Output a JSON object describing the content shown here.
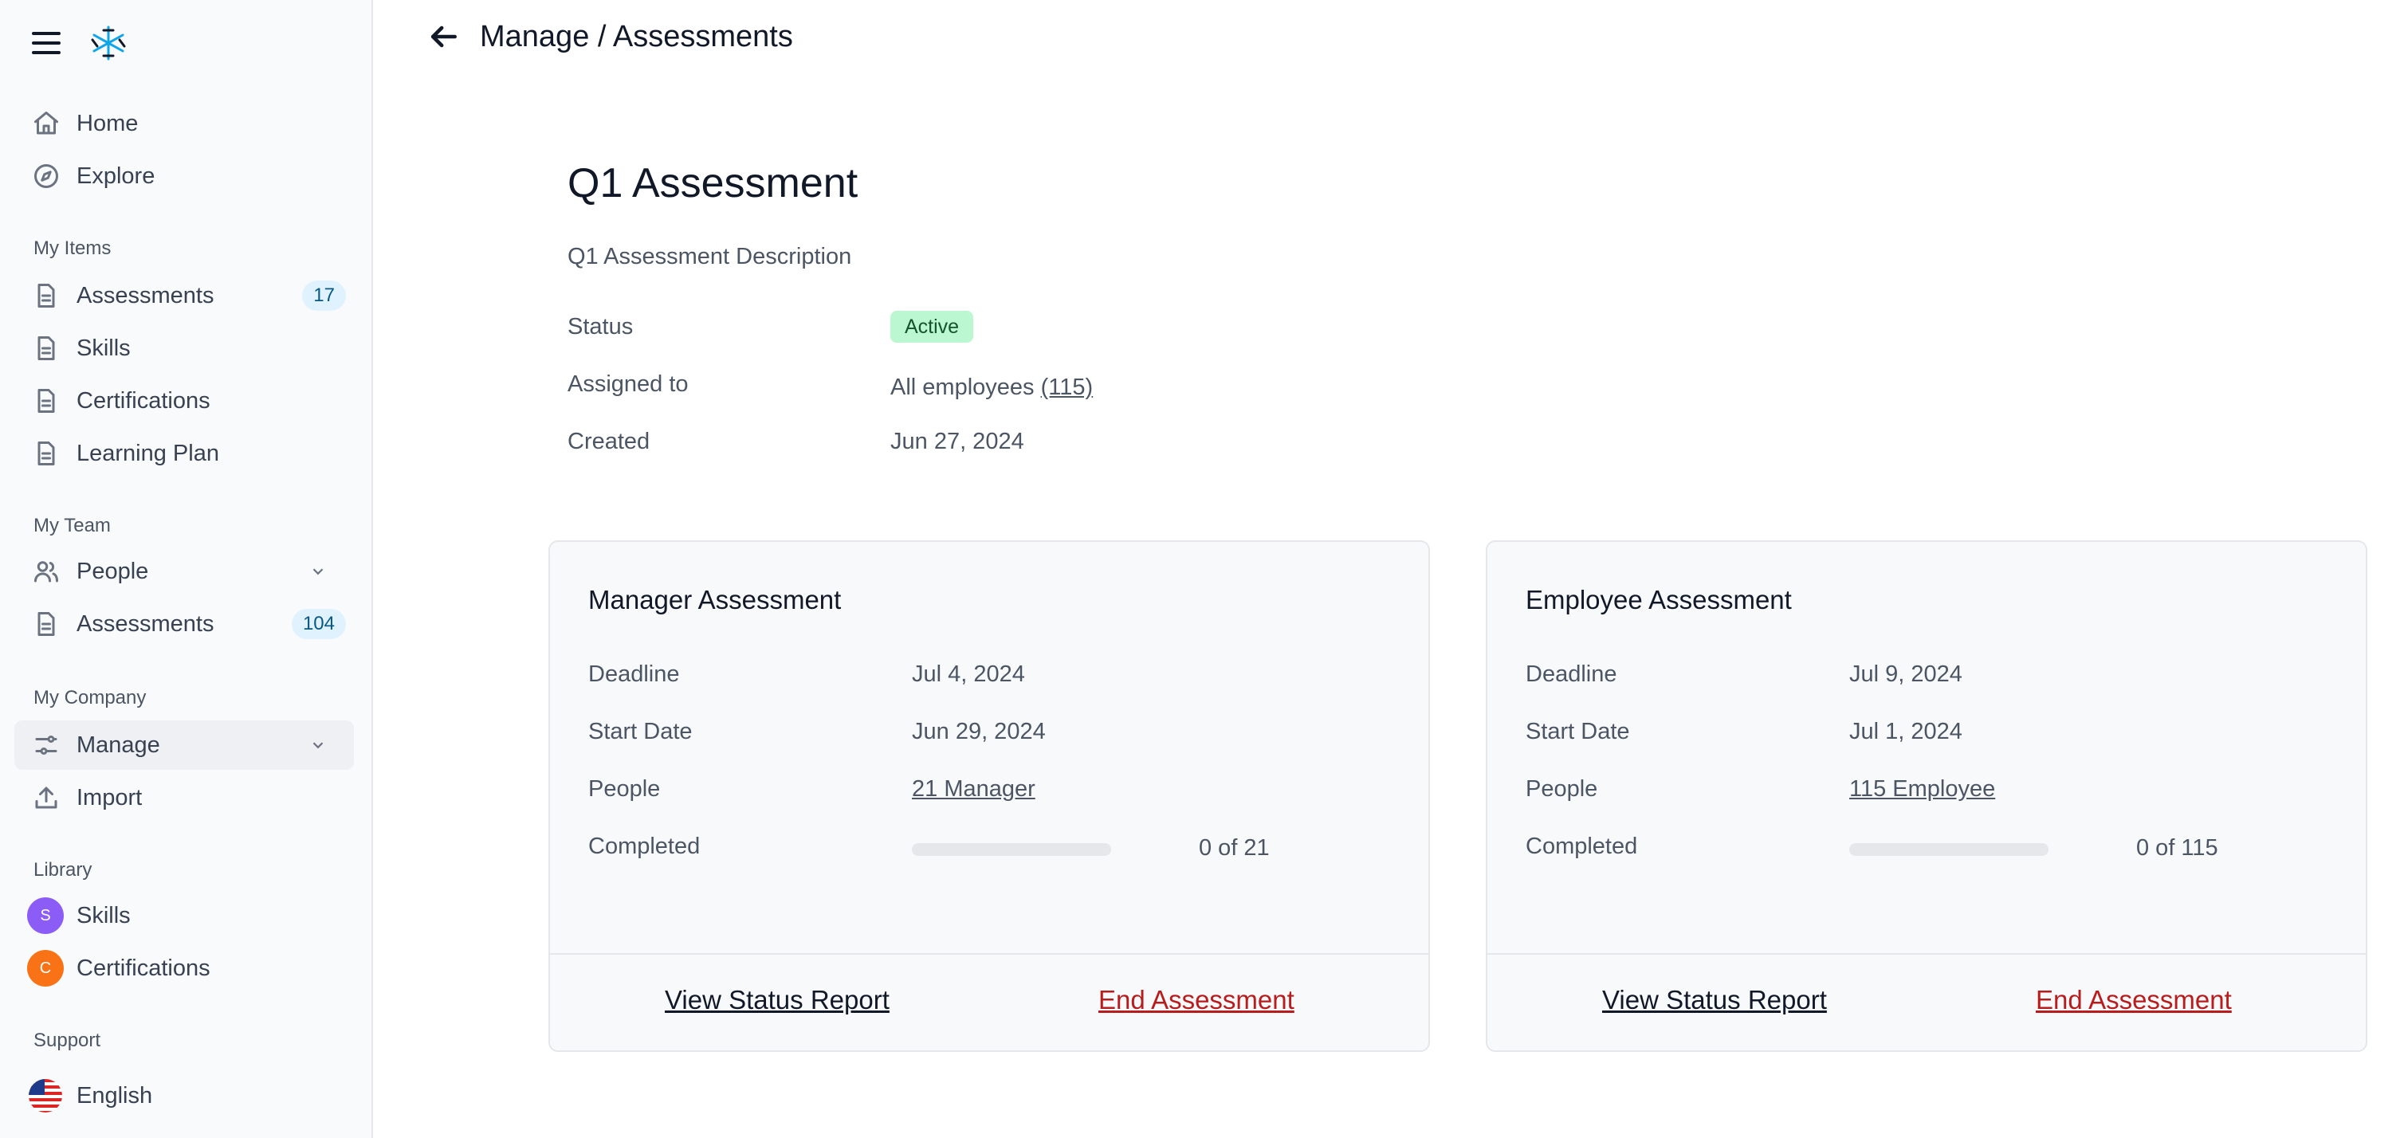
{
  "sidebar": {
    "nav": [
      {
        "label": "Home",
        "icon": "home-icon"
      },
      {
        "label": "Explore",
        "icon": "compass-icon"
      }
    ],
    "my_items": {
      "heading": "My Items",
      "items": [
        {
          "label": "Assessments",
          "badge": "17"
        },
        {
          "label": "Skills"
        },
        {
          "label": "Certifications"
        },
        {
          "label": "Learning Plan"
        }
      ]
    },
    "my_team": {
      "heading": "My Team",
      "items": [
        {
          "label": "People"
        },
        {
          "label": "Assessments",
          "badge": "104"
        }
      ]
    },
    "my_company": {
      "heading": "My Company",
      "items": [
        {
          "label": "Manage"
        },
        {
          "label": "Import"
        }
      ]
    },
    "library": {
      "heading": "Library",
      "items": [
        {
          "label": "Skills",
          "avatar": "S",
          "color": "#8b5cf6"
        },
        {
          "label": "Certifications",
          "avatar": "C",
          "color": "#f97316"
        }
      ]
    },
    "support": {
      "heading": "Support",
      "language": "English"
    }
  },
  "header": {
    "breadcrumb": "Manage / Assessments"
  },
  "assessment": {
    "title": "Q1 Assessment",
    "description": "Q1 Assessment Description",
    "status_label": "Status",
    "status": "Active",
    "assigned_label": "Assigned to",
    "assigned_to": "All employees",
    "assigned_count": "(115)",
    "created_label": "Created",
    "created": "Jun 27, 2024"
  },
  "cards": [
    {
      "title": "Manager Assessment",
      "deadline_label": "Deadline",
      "deadline": "Jul 4, 2024",
      "start_label": "Start Date",
      "start": "Jun 29, 2024",
      "people_label": "People",
      "people": "21 Manager",
      "completed_label": "Completed",
      "completed_text": "0 of 21",
      "completed_fraction": 0,
      "report_label": "View Status Report",
      "end_label": "End Assessment"
    },
    {
      "title": "Employee Assessment",
      "deadline_label": "Deadline",
      "deadline": "Jul 9, 2024",
      "start_label": "Start Date",
      "start": "Jul 1, 2024",
      "people_label": "People",
      "people": "115 Employee",
      "completed_label": "Completed",
      "completed_text": "0 of 115",
      "completed_fraction": 0,
      "report_label": "View Status Report",
      "end_label": "End Assessment"
    }
  ],
  "colors": {
    "active_badge_bg": "#bbf7d0",
    "end_link": "#b91c1c",
    "count_badge_bg": "#e0f2fe"
  }
}
